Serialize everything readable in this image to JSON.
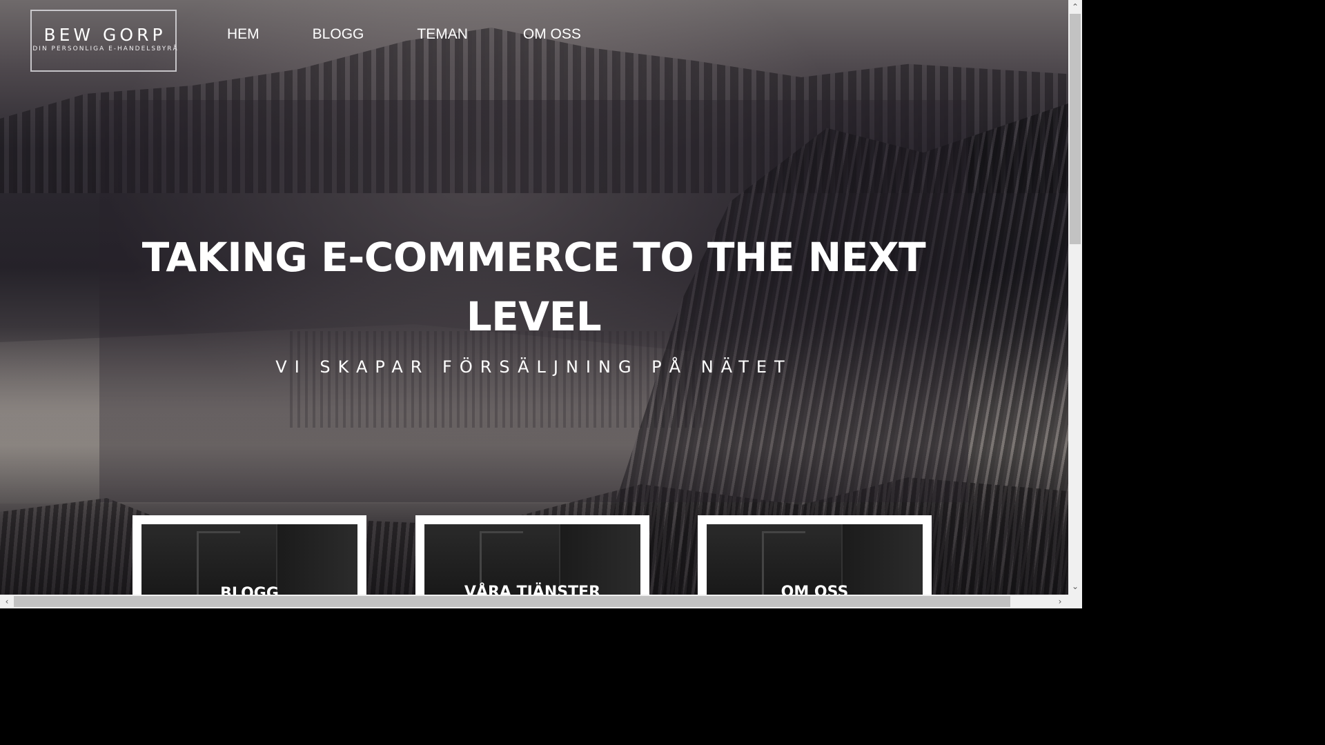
{
  "logo": {
    "title": "BEW GORP",
    "tagline": "DIN PERSONLIGA E-HANDELSBYRÅ"
  },
  "nav": {
    "items": [
      {
        "label": "HEM"
      },
      {
        "label": "BLOGG"
      },
      {
        "label": "TEMAN"
      },
      {
        "label": "OM OSS"
      }
    ]
  },
  "hero": {
    "title": "TAKING E-COMMERCE TO THE NEXT LEVEL",
    "subtitle": "VI SKAPAR FÖRSÄLJNING PÅ NÄTET"
  },
  "cards": [
    {
      "label": "BLOGG"
    },
    {
      "label": "VÅRA TJÄNSTER"
    },
    {
      "label": "OM OSS"
    }
  ],
  "scrollbars": {
    "up_arrow": "⌃",
    "down_arrow": "⌄",
    "left_arrow": "‹",
    "right_arrow": "›"
  },
  "colors": {
    "text": "#ffffff",
    "card_border": "#ffffff",
    "scrollbar_track": "#f0f0f0",
    "scrollbar_thumb": "#c2c2c2"
  }
}
